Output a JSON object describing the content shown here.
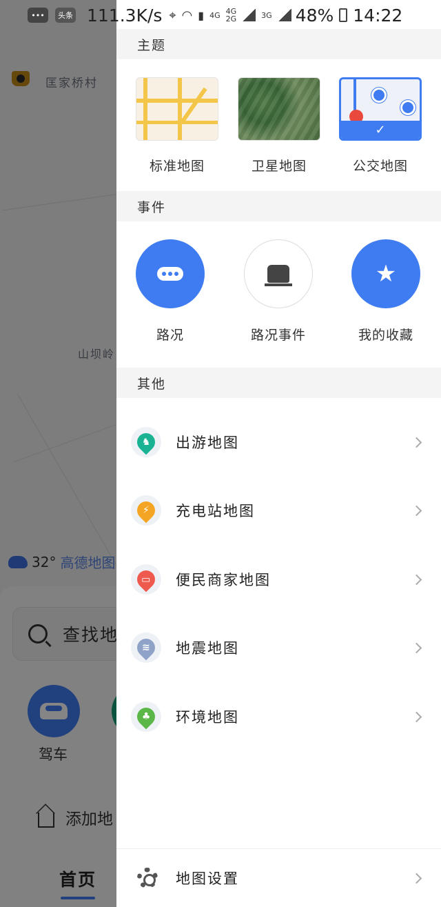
{
  "status_bar": {
    "notif_chip": "头条",
    "net_speed": "111.3K/s",
    "net1": "4G",
    "net2": "4G",
    "net2_sub": "2G",
    "net3": "3G",
    "battery": "48%",
    "time": "14:22"
  },
  "background": {
    "village_label": "匡家桥村",
    "place_label": "山坝岭",
    "temperature": "32°",
    "brand": "高德地图",
    "search_placeholder": "查找地",
    "drive_label": "驾车",
    "add_label": "添加地",
    "home_tab": "首页"
  },
  "drawer": {
    "themes_header": "主题",
    "themes": [
      {
        "label": "标准地图"
      },
      {
        "label": "卫星地图"
      },
      {
        "label": "公交地图",
        "selected": true
      }
    ],
    "events_header": "事件",
    "events": [
      {
        "label": "路况",
        "icon": "traffic-dots-icon"
      },
      {
        "label": "路况事件",
        "icon": "road-event-icon"
      },
      {
        "label": "我的收藏",
        "icon": "star-icon"
      }
    ],
    "other_header": "其他",
    "others": [
      {
        "label": "出游地图",
        "icon": "horse-icon",
        "color": "#19b394"
      },
      {
        "label": "充电站地图",
        "icon": "charging-icon",
        "color": "#f5a524"
      },
      {
        "label": "便民商家地图",
        "icon": "shop-icon",
        "color": "#ef5a4f"
      },
      {
        "label": "地震地图",
        "icon": "earthquake-icon",
        "color": "#8fa3c8"
      },
      {
        "label": "环境地图",
        "icon": "tree-icon",
        "color": "#5bb748"
      }
    ],
    "settings_label": "地图设置",
    "accent_color": "#3f7cf2"
  }
}
